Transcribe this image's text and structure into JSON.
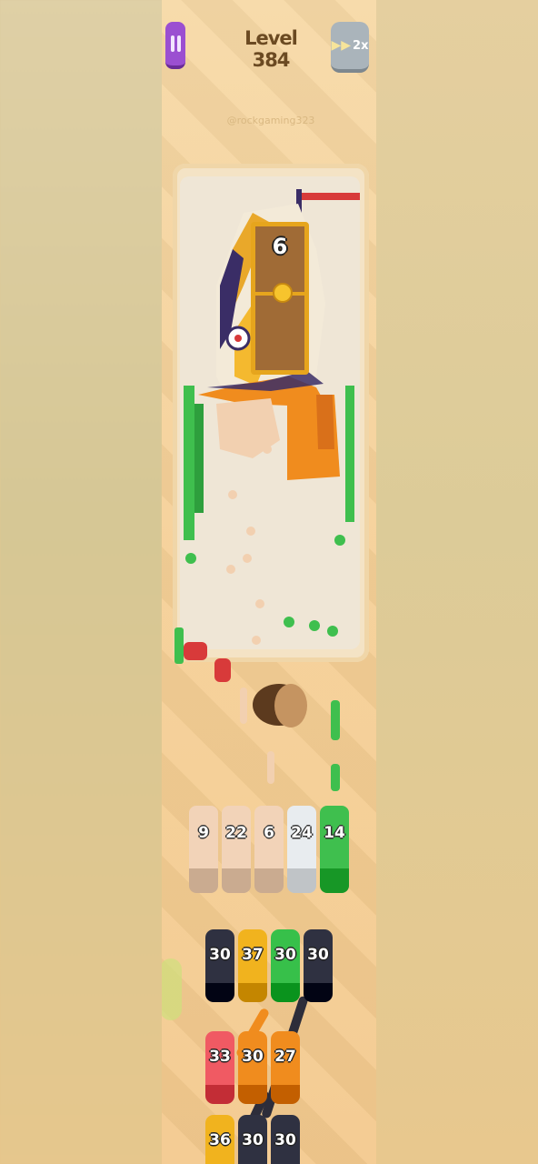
{
  "hud": {
    "level_label": "Level 384",
    "speed_label": "2x",
    "watermark": "@rockgaming323"
  },
  "board": {
    "chest_count": "6"
  },
  "collector_slots": [
    {
      "value": "9",
      "color": "#f2d3b8"
    },
    {
      "value": "22",
      "color": "#f2d3b8"
    },
    {
      "value": "6",
      "color": "#f2d3b8"
    },
    {
      "value": "24",
      "color": "#e8ecef"
    },
    {
      "value": "14",
      "color": "#3fbf4e"
    }
  ],
  "queue_row1": [
    {
      "value": "30",
      "color": "#2f3141"
    },
    {
      "value": "37",
      "color": "#f1b31e"
    },
    {
      "value": "30",
      "color": "#37c04a"
    },
    {
      "value": "30",
      "color": "#2f3141"
    }
  ],
  "queue_row2": [
    {
      "value": "33",
      "color": "#f05a63"
    },
    {
      "value": "30",
      "color": "#f08c1e"
    },
    {
      "value": "27",
      "color": "#f08c1e"
    }
  ],
  "queue_row3": [
    {
      "value": "36",
      "color": "#f1b31e"
    },
    {
      "value": "30",
      "color": "#2f3141"
    },
    {
      "value": "30",
      "color": "#2f3141"
    }
  ],
  "icons": {
    "pause": "pause-icon",
    "speed": "fast-forward-icon"
  }
}
